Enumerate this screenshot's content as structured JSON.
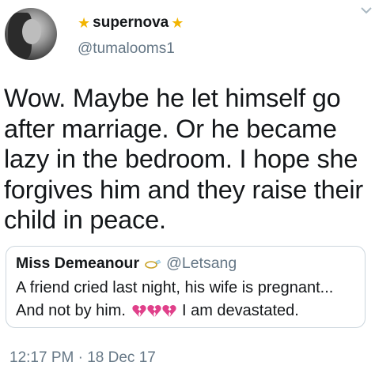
{
  "author": {
    "star_left": "★",
    "display_name": "supernova",
    "star_right": "★",
    "handle": "@tumalooms1",
    "avatar_icon": "profile-photo"
  },
  "tweet": {
    "text": "Wow. Maybe he let himself go after marriage. Or he became lazy in the bedroom. I hope she forgives him and they raise their child in peace."
  },
  "quoted_tweet": {
    "display_name": "Miss Demeanour",
    "name_icon": "ring-icon",
    "handle": "@Letsang",
    "line1": "A friend cried last night, his wife is pregnant...",
    "line2_start": "And not by him.",
    "hearts_icon": "broken-heart-icon",
    "hearts_count": 3,
    "line2_end": "I am devastated."
  },
  "timestamp": "12:17 PM · 18 Dec 17",
  "colors": {
    "star": "#f2b400",
    "secondary_text": "#657786",
    "heart": "#e0408a",
    "border": "#ccd6dd"
  }
}
